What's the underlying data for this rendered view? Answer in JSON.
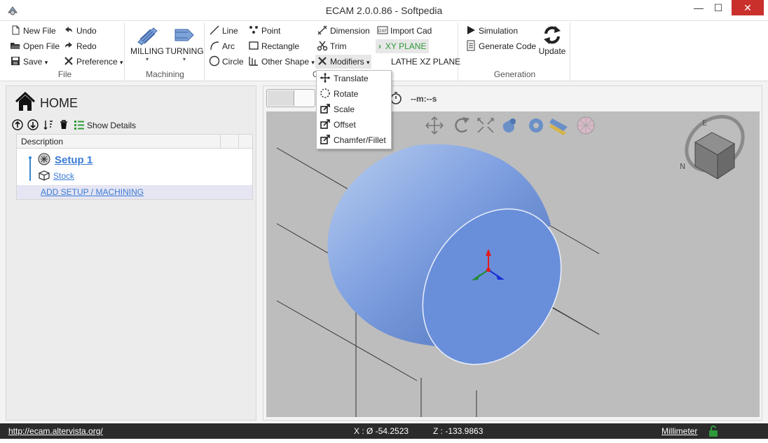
{
  "window": {
    "title": "ECAM 2.0.0.86 - Softpedia",
    "minimize_glyph": "—",
    "maximize_glyph": "☐",
    "close_glyph": "✕"
  },
  "ribbon": {
    "file": {
      "label": "File",
      "new_file": "New File",
      "open_file": "Open File",
      "save": "Save",
      "undo": "Undo",
      "redo": "Redo",
      "preference": "Preference"
    },
    "machining": {
      "label": "Machining",
      "milling": "MILLING",
      "turning": "TURNING"
    },
    "cad": {
      "label": "C",
      "line": "Line",
      "arc": "Arc",
      "circle": "Circle",
      "point": "Point",
      "rectangle": "Rectangle",
      "other_shape": "Other Shape",
      "dimension": "Dimension",
      "trim": "Trim",
      "modifiers": "Modifiers",
      "import_cad": "Import Cad",
      "xy_plane": "XY PLANE",
      "lathe_xz_plane": "LATHE XZ PLANE"
    },
    "generation": {
      "label": "Generation",
      "simulation": "Simulation",
      "generate_code": "Generate Code",
      "update": "Update"
    }
  },
  "modifiers_menu": [
    "Translate",
    "Rotate",
    "Scale",
    "Offset",
    "Chamfer/Fillet"
  ],
  "left_panel": {
    "home": "HOME",
    "show_details": "Show Details",
    "column_description": "Description",
    "setup": "Setup 1",
    "stock": "Stock",
    "add_setup": "ADD SETUP / MACHINING"
  },
  "viewport": {
    "timer": "--m:--s",
    "axis_colors": {
      "x": "#1a2fd6",
      "y": "#1f8a2f",
      "z": "#e01b1b"
    },
    "cylinder_color": "#7e9fe0",
    "background": "#bdbdbd",
    "compass_labels": [
      "E",
      "N"
    ]
  },
  "status": {
    "url": "http://ecam.altervista.org/",
    "x": "X : Ø -54.2523",
    "z": "Z : -133.9863",
    "unit": "Millimeter",
    "lock_color": "#2e9a3a"
  }
}
